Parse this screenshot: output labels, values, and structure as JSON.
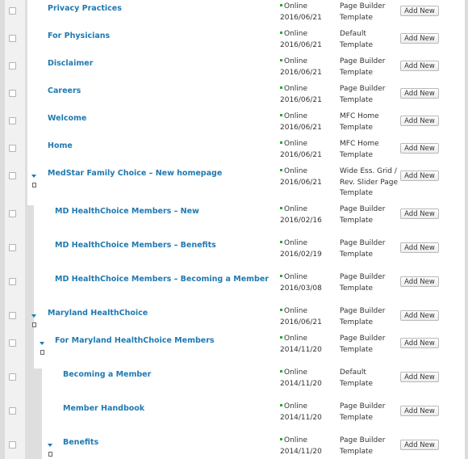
{
  "rows": [
    {
      "title": "Privacy Practices",
      "status": "Online",
      "date": "2016/06/21",
      "template": "Page Builder Template",
      "button": "Add New"
    },
    {
      "title": "For Physicians",
      "status": "Online",
      "date": "2016/06/21",
      "template": "Default Template",
      "button": "Add New"
    },
    {
      "title": "Disclaimer",
      "status": "Online",
      "date": "2016/06/21",
      "template": "Page Builder Template",
      "button": "Add New"
    },
    {
      "title": "Careers",
      "status": "Online",
      "date": "2016/06/21",
      "template": "Page Builder Template",
      "button": "Add New"
    },
    {
      "title": "Welcome",
      "status": "Online",
      "date": "2016/06/21",
      "template": "MFC Home Template",
      "button": "Add New"
    },
    {
      "title": "Home",
      "status": "Online",
      "date": "2016/06/21",
      "template": "MFC Home Template",
      "button": "Add New"
    },
    {
      "title": "MedStar Family Choice – New homepage",
      "status": "Online",
      "date": "2016/06/21",
      "template": "Wide Ess. Grid / Rev. Slider Page Template",
      "button": "Add New"
    },
    {
      "title": "MD HealthChoice Members – New",
      "status": "Online",
      "date": "2016/02/16",
      "template": "Page Builder Template",
      "button": "Add New"
    },
    {
      "title": "MD HealthChoice Members – Benefits",
      "status": "Online",
      "date": "2016/02/19",
      "template": "Page Builder Template",
      "button": "Add New"
    },
    {
      "title": "MD HealthChoice Members – Becoming a Member",
      "status": "Online",
      "date": "2016/03/08",
      "template": "Page Builder Template",
      "button": "Add New"
    },
    {
      "title": "Maryland HealthChoice",
      "status": "Online",
      "date": "2016/06/21",
      "template": "Page Builder Template",
      "button": "Add New"
    },
    {
      "title": "For Maryland HealthChoice Members",
      "status": "Online",
      "date": "2014/11/20",
      "template": "Page Builder Template",
      "button": "Add New"
    },
    {
      "title": "Becoming a Member",
      "status": "Online",
      "date": "2014/11/20",
      "template": "Default Template",
      "button": "Add New"
    },
    {
      "title": "Member Handbook",
      "status": "Online",
      "date": "2014/11/20",
      "template": "Page Builder Template",
      "button": "Add New"
    },
    {
      "title": "Benefits",
      "status": "Online",
      "date": "2014/11/20",
      "template": "Page Builder Template",
      "button": "Add New"
    }
  ],
  "colors": {
    "link": "#1f79b1",
    "online": "#2ea82e",
    "tree_bar": "#dedede"
  },
  "icons": {
    "expand": "caret-down-icon",
    "page": "page-icon",
    "status": "status-dot-icon"
  }
}
